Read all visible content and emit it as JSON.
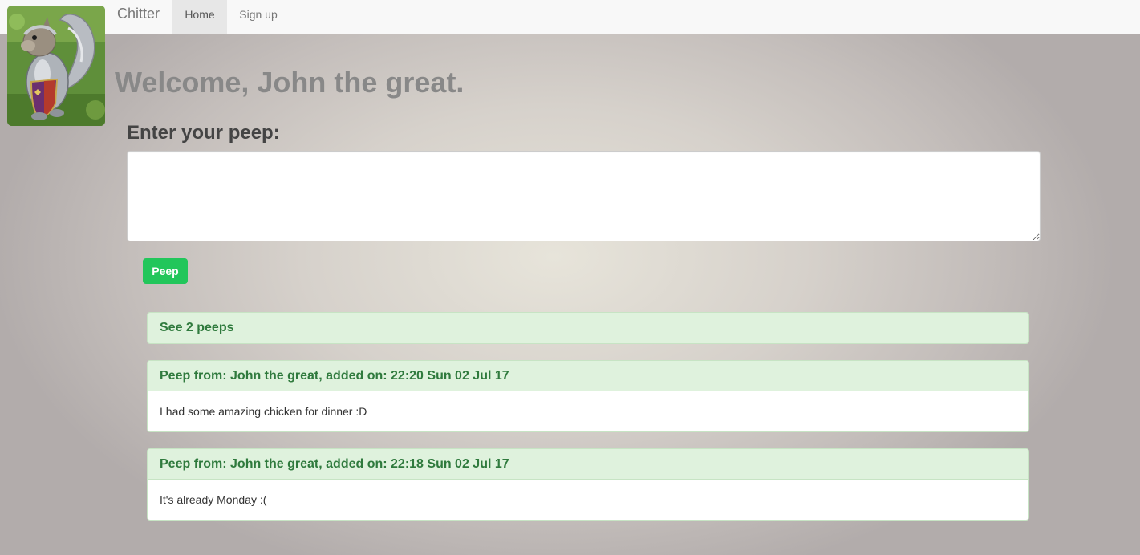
{
  "navbar": {
    "brand": "Chitter",
    "items": [
      {
        "label": "Home",
        "active": true
      },
      {
        "label": "Sign up",
        "active": false
      }
    ]
  },
  "logo": {
    "icon": "armored-squirrel-logo"
  },
  "welcome": "Welcome, John the great.",
  "form": {
    "label": "Enter your peep:",
    "textarea_value": "",
    "button_label": "Peep"
  },
  "peeps_count_label": "See 2 peeps",
  "peeps": [
    {
      "heading": "Peep from: John the great, added on: 22:20 Sun 02 Jul 17",
      "body": "I had some amazing chicken for dinner :D"
    },
    {
      "heading": "Peep from: John the great, added on: 22:18 Sun 02 Jul 17",
      "body": "It's already Monday :("
    }
  ],
  "colors": {
    "primary_button": "#22c65b",
    "panel_heading_bg": "#dff2dd",
    "panel_heading_text": "#2f7a3d"
  }
}
